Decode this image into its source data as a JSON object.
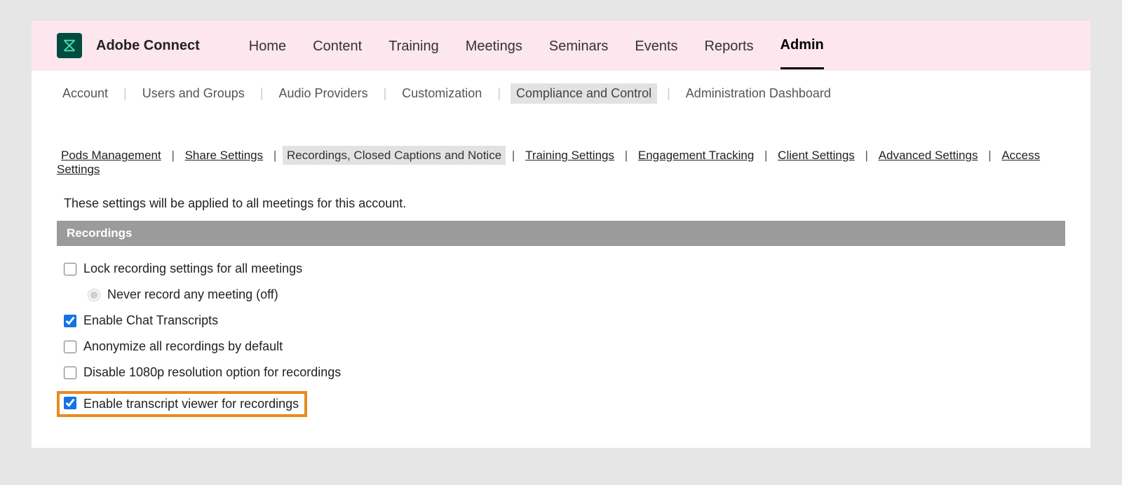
{
  "product": "Adobe Connect",
  "mainnav": [
    {
      "label": "Home",
      "active": false
    },
    {
      "label": "Content",
      "active": false
    },
    {
      "label": "Training",
      "active": false
    },
    {
      "label": "Meetings",
      "active": false
    },
    {
      "label": "Seminars",
      "active": false
    },
    {
      "label": "Events",
      "active": false
    },
    {
      "label": "Reports",
      "active": false
    },
    {
      "label": "Admin",
      "active": true
    }
  ],
  "subnav": [
    {
      "label": "Account",
      "active": false
    },
    {
      "label": "Users and Groups",
      "active": false
    },
    {
      "label": "Audio Providers",
      "active": false
    },
    {
      "label": "Customization",
      "active": false
    },
    {
      "label": "Compliance and Control",
      "active": true
    },
    {
      "label": "Administration Dashboard",
      "active": false
    }
  ],
  "tabs": [
    {
      "label": "Pods Management",
      "active": false
    },
    {
      "label": "Share Settings",
      "active": false
    },
    {
      "label": "Recordings, Closed Captions and Notice",
      "active": true
    },
    {
      "label": "Training Settings",
      "active": false
    },
    {
      "label": "Engagement Tracking",
      "active": false
    },
    {
      "label": "Client Settings",
      "active": false
    },
    {
      "label": "Advanced Settings",
      "active": false
    },
    {
      "label": "Access Settings",
      "active": false
    }
  ],
  "intro": "These settings will be applied to all meetings for this account.",
  "section_title": "Recordings",
  "options": {
    "lock_recording": {
      "label": "Lock recording settings for all meetings",
      "checked": false
    },
    "never_record": {
      "label": "Never record any meeting (off)",
      "selected": true
    },
    "enable_chat_transcripts": {
      "label": "Enable Chat Transcripts",
      "checked": true
    },
    "anonymize": {
      "label": "Anonymize all recordings by default",
      "checked": false
    },
    "disable_1080p": {
      "label": "Disable 1080p resolution option for recordings",
      "checked": false
    },
    "enable_transcript_viewer": {
      "label": "Enable transcript viewer for recordings",
      "checked": true
    }
  }
}
